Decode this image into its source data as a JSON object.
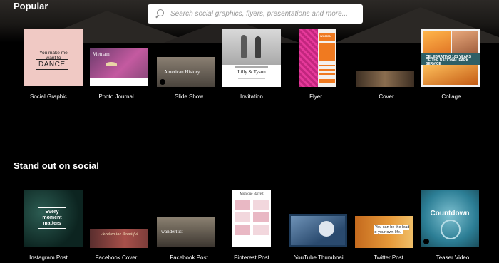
{
  "search": {
    "placeholder": "Search social graphics, flyers, presentations and more..."
  },
  "sections": {
    "popular": {
      "title": "Popular",
      "tiles": [
        {
          "label": "Social Graphic",
          "thumb_text": [
            "You make me want to",
            "DANCE"
          ]
        },
        {
          "label": "Photo Journal",
          "thumb_text": [
            "Vietnam"
          ]
        },
        {
          "label": "Slide Show",
          "thumb_text": [
            "American History"
          ]
        },
        {
          "label": "Invitation",
          "thumb_text": [
            "Lilly & Tyson"
          ]
        },
        {
          "label": "Flyer",
          "thumb_text": [
            "WOMEN"
          ]
        },
        {
          "label": "Cover",
          "thumb_text": []
        },
        {
          "label": "Collage",
          "thumb_text": [
            "CELEBRATING 101 YEARS OF THE NATIONAL PARK SERVICE"
          ]
        }
      ]
    },
    "social": {
      "title": "Stand out on social",
      "tiles": [
        {
          "label": "Instagram Post",
          "thumb_text": [
            "Every moment matters"
          ]
        },
        {
          "label": "Facebook Cover",
          "thumb_text": [
            "Awaken the Beautiful"
          ]
        },
        {
          "label": "Facebook Post",
          "thumb_text": [
            "wanderlust"
          ]
        },
        {
          "label": "Pinterest Post",
          "thumb_text": [
            "Monique Barrett"
          ]
        },
        {
          "label": "YouTube Thumbnail",
          "thumb_text": []
        },
        {
          "label": "Twitter Post",
          "thumb_text": [
            "You can be the lead to your own life."
          ]
        },
        {
          "label": "Teaser Video",
          "thumb_text": [
            "Countdown"
          ]
        }
      ]
    }
  },
  "colors": {
    "background": "#000000",
    "search_bg": "#ffffff",
    "text": "#ffffff"
  },
  "icons": {
    "search": "search-icon",
    "play": "play-icon"
  }
}
